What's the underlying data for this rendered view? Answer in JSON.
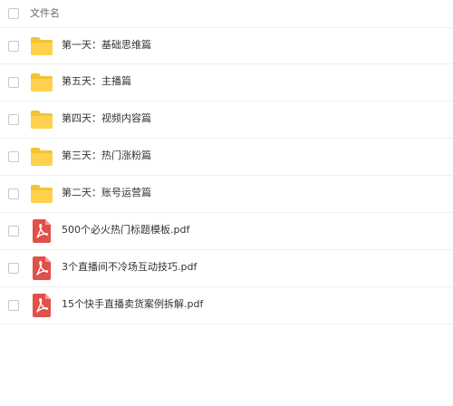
{
  "header": {
    "column_label": "文件名"
  },
  "colors": {
    "folder": "#FFD24D",
    "folder_tab": "#F5C233",
    "pdf": "#E2504A",
    "divider": "#EFEFEF",
    "text": "#333333"
  },
  "files": [
    {
      "name": "第一天：基础思维篇",
      "icon": "folder-icon"
    },
    {
      "name": "第五天：主播篇",
      "icon": "folder-icon"
    },
    {
      "name": "第四天：视频内容篇",
      "icon": "folder-icon"
    },
    {
      "name": "第三天：热门涨粉篇",
      "icon": "folder-icon"
    },
    {
      "name": "第二天：账号运营篇",
      "icon": "folder-icon"
    },
    {
      "name": "500个必火热门标题模板.pdf",
      "icon": "pdf-icon"
    },
    {
      "name": "3个直播间不冷场互动技巧.pdf",
      "icon": "pdf-icon"
    },
    {
      "name": "15个快手直播卖货案例拆解.pdf",
      "icon": "pdf-icon"
    }
  ]
}
